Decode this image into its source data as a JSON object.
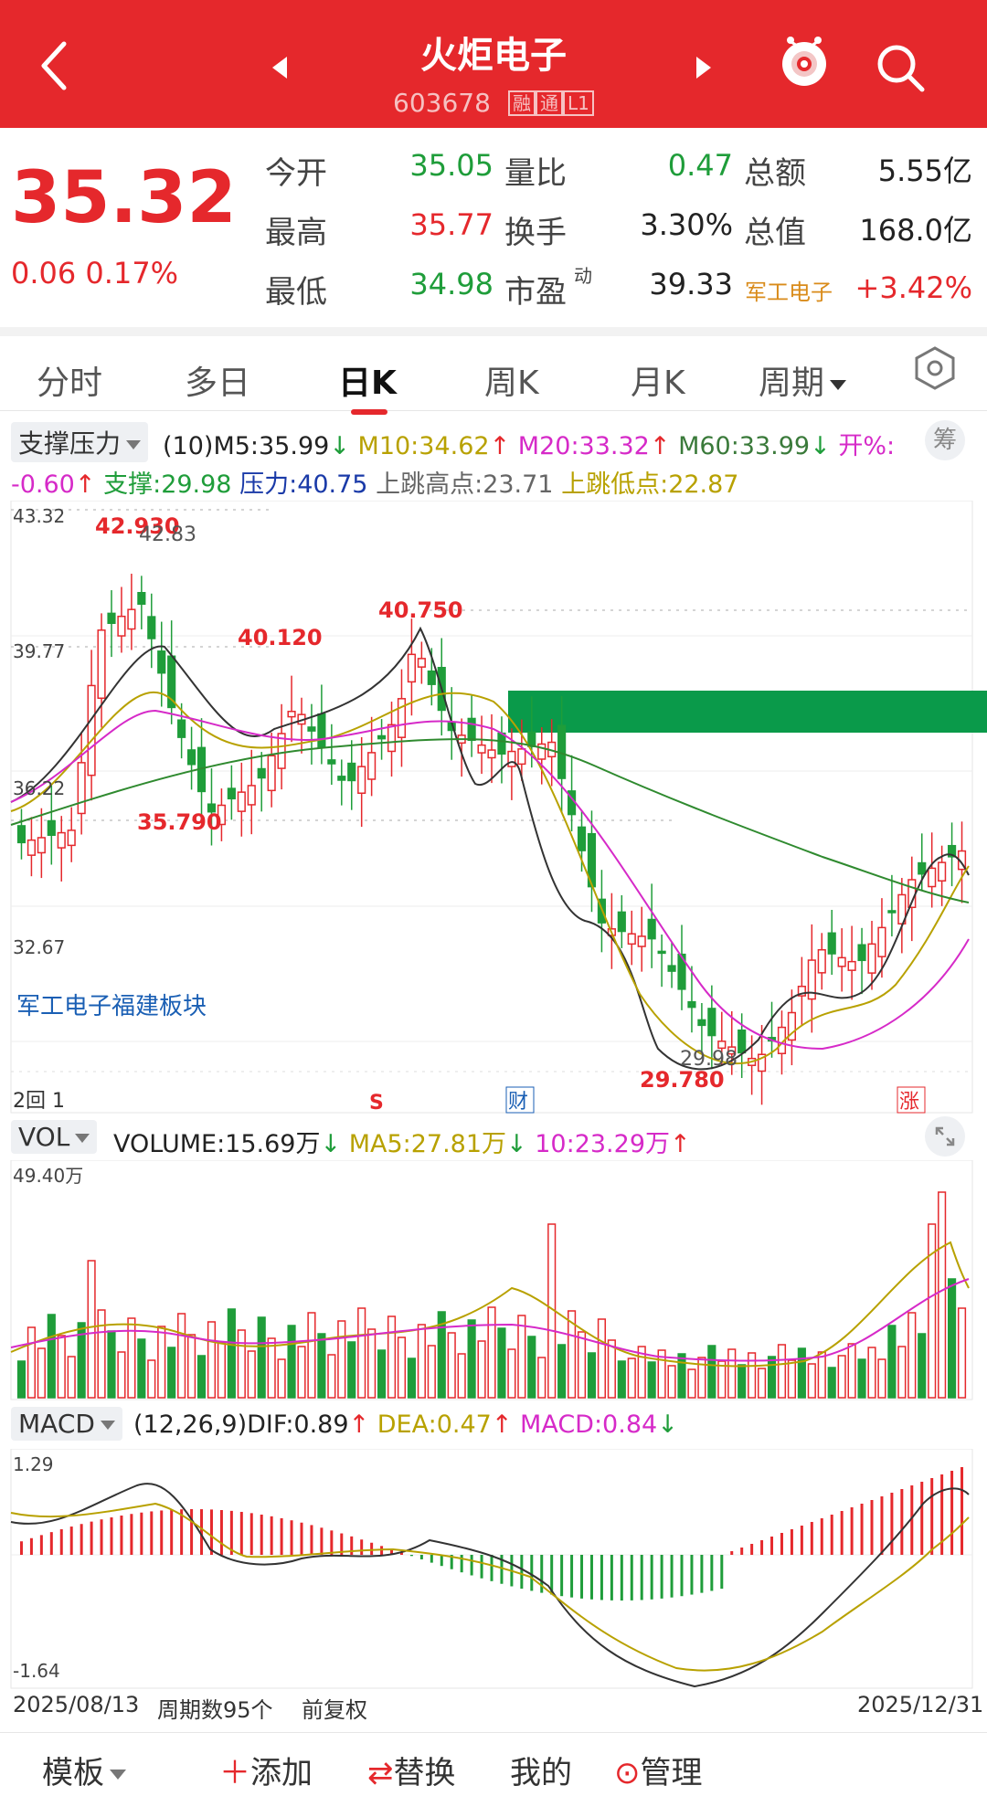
{
  "header": {
    "title": "火炬电子",
    "code": "603678",
    "tags": [
      "融",
      "通",
      "L1"
    ]
  },
  "quote": {
    "price": "35.32",
    "change": "0.06",
    "change_pct": "0.17%",
    "rows": [
      {
        "l1": "今开",
        "v1": "35.05",
        "l2": "量比",
        "v2": "0.47",
        "l3": "总额",
        "v3": "5.55亿"
      },
      {
        "l1": "最高",
        "v1": "35.77",
        "l2": "换手",
        "v2": "3.30%",
        "l3": "总值",
        "v3": "168.0亿"
      },
      {
        "l1": "最低",
        "v1": "34.98",
        "l2": "市盈",
        "v2": "39.33",
        "sup2": "动"
      }
    ],
    "sector_name": "军工电子",
    "sector_change": "+3.42%"
  },
  "tabs": [
    "分时",
    "多日",
    "日K",
    "周K",
    "月K",
    "周期"
  ],
  "indicators": {
    "main_select": "支撑压力",
    "main_line1": {
      "params": "(10)",
      "m5": "M5:35.99",
      "m10": "M10:34.62",
      "m20": "M20:33.32",
      "m60": "M60:33.99",
      "open_pct": "开%:"
    },
    "main_line2": {
      "open_val": "-0.60",
      "support": "支撑:29.98",
      "pressure": "压力:40.75",
      "gap_high": "上跳高点:23.71",
      "gap_low": "上跳低点:22.87"
    },
    "chip": "筹",
    "vol_select": "VOL",
    "vol_line": {
      "volume": "VOLUME:15.69万",
      "ma5": "MA5:27.81万",
      "ma10": "10:23.29万"
    },
    "macd_select": "MACD",
    "macd_line": {
      "params": "(12,26,9)",
      "dif": "DIF:0.89",
      "dea": "DEA:0.47",
      "macd": "MACD:0.84"
    }
  },
  "kchart": {
    "y_labels": [
      "43.32",
      "39.77",
      "36.22",
      "32.67"
    ],
    "annotations": {
      "high": "42.930",
      "high2": "42.83",
      "p1": "40.120",
      "p2": "40.750",
      "low1": "35.790",
      "low2": "29.780",
      "low3": "29.98"
    },
    "sector_label": "军工电子福建板块",
    "markers": {
      "left": "2回 1",
      "s": "S",
      "cai": "财",
      "zhang": "涨"
    }
  },
  "chart_data": {
    "type": "candlestick",
    "x_range": [
      "2025/08/13",
      "2025/12/31"
    ],
    "ylim": [
      29.78,
      43.32
    ],
    "ma_last": {
      "M5": 35.99,
      "M10": 34.62,
      "M20": 33.32,
      "M60": 33.99
    },
    "support": 29.98,
    "pressure": 40.75,
    "high": 42.93,
    "low": 29.78,
    "volume_max": "49.40万",
    "macd_range": [
      -1.64,
      1.29
    ],
    "period_count": 95
  },
  "vol": {
    "max_label": "49.40万"
  },
  "macd": {
    "top_label": "1.29",
    "bottom_label": "-1.64"
  },
  "footer": {
    "start": "2025/08/13",
    "count": "周期数95个",
    "adj": "前复权",
    "end": "2025/12/31"
  },
  "bottom": {
    "template": "模板",
    "add": "添加",
    "replace": "替换",
    "mine": "我的",
    "manage": "管理"
  },
  "colors": {
    "brand": "#e5282c",
    "green": "#1f9d3a"
  }
}
